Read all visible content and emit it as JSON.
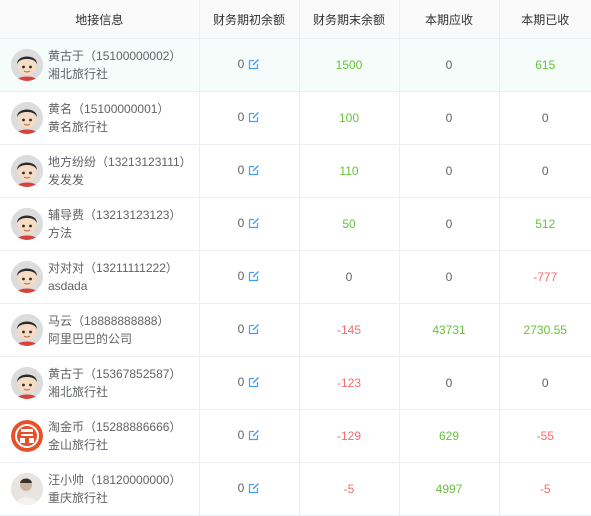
{
  "headers": [
    "地接信息",
    "财务期初余额",
    "财务期末余额",
    "本期应收",
    "本期已收"
  ],
  "colors": {
    "positive": "#67c23a",
    "negative": "#f56c6c",
    "neutral": "#606266",
    "edit_icon": "#409eff"
  },
  "rows": [
    {
      "name": "黄古于",
      "phone": "（15100000002）",
      "company": "湘北旅行社",
      "avatar": "cartoon-boy",
      "opening": "0",
      "closing": "1500",
      "receivable": "0",
      "received": "615",
      "tone": [
        "plain",
        "green",
        "plain",
        "green"
      ],
      "highlight": true
    },
    {
      "name": "黄名",
      "phone": "（15100000001）",
      "company": "黄名旅行社",
      "avatar": "cartoon-boy",
      "opening": "0",
      "closing": "100",
      "receivable": "0",
      "received": "0",
      "tone": [
        "plain",
        "green",
        "plain",
        "plain"
      ],
      "highlight": false
    },
    {
      "name": "地方纷纷",
      "phone": "（13213123111）",
      "company": "发发发",
      "avatar": "cartoon-boy",
      "opening": "0",
      "closing": "110",
      "receivable": "0",
      "received": "0",
      "tone": [
        "plain",
        "green",
        "plain",
        "plain"
      ],
      "highlight": false
    },
    {
      "name": "辅导费",
      "phone": "（13213123123）",
      "company": "方法",
      "avatar": "cartoon-boy",
      "opening": "0",
      "closing": "50",
      "receivable": "0",
      "received": "512",
      "tone": [
        "plain",
        "green",
        "plain",
        "green"
      ],
      "highlight": false
    },
    {
      "name": "对对对",
      "phone": "（13211111222）",
      "company": "asdada",
      "avatar": "cartoon-boy",
      "opening": "0",
      "closing": "0",
      "receivable": "0",
      "received": "-777",
      "tone": [
        "plain",
        "plain",
        "plain",
        "red"
      ],
      "highlight": false
    },
    {
      "name": "马云",
      "phone": "（18888888888）",
      "company": "阿里巴巴的公司",
      "avatar": "cartoon-boy",
      "opening": "0",
      "closing": "-145",
      "receivable": "43731",
      "received": "2730.55",
      "tone": [
        "plain",
        "red",
        "green",
        "green"
      ],
      "highlight": false
    },
    {
      "name": "黄古于",
      "phone": "（15367852587）",
      "company": "湘北旅行社",
      "avatar": "cartoon-boy",
      "opening": "0",
      "closing": "-123",
      "receivable": "0",
      "received": "0",
      "tone": [
        "plain",
        "red",
        "plain",
        "plain"
      ],
      "highlight": false
    },
    {
      "name": "淘金币",
      "phone": "（15288886666）",
      "company": "金山旅行社",
      "avatar": "red-logo",
      "opening": "0",
      "closing": "-129",
      "receivable": "629",
      "received": "-55",
      "tone": [
        "plain",
        "red",
        "green",
        "red"
      ],
      "highlight": false
    },
    {
      "name": "汪小帅",
      "phone": "（18120000000）",
      "company": "重庆旅行社",
      "avatar": "photo",
      "opening": "0",
      "closing": "-5",
      "receivable": "4997",
      "received": "-5",
      "tone": [
        "plain",
        "red",
        "green",
        "red"
      ],
      "highlight": false
    }
  ]
}
